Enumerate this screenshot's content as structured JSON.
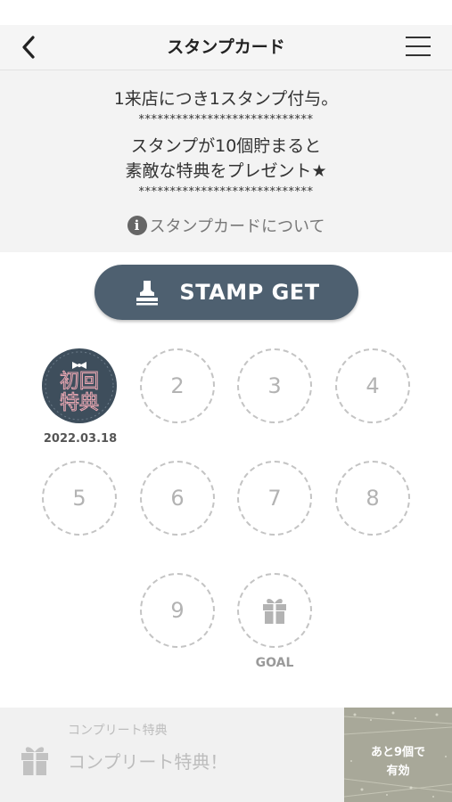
{
  "nav": {
    "title": "スタンプカード"
  },
  "info": {
    "line1": "1来店につき1スタンプ付与。",
    "stars1": "****************************",
    "line2": "スタンプが10個貯まると",
    "line3": "素敵な特典をプレゼント★",
    "stars2": "****************************",
    "about_label": "スタンプカードについて",
    "about_icon": "i"
  },
  "stamp_button": {
    "label": "STAMP GET",
    "icon": "stamp-icon"
  },
  "stamps": {
    "first": {
      "badge_line1": "初回",
      "badge_line2": "特典",
      "date": "2022.03.18"
    },
    "empty_numbers": [
      "2",
      "3",
      "4",
      "5",
      "6",
      "7",
      "8",
      "9"
    ],
    "goal_label": "GOAL",
    "goal_icon": "gift-icon"
  },
  "reward": {
    "sub_label": "コンプリート特典",
    "title": "コンプリート特典！",
    "remaining_line1": "あと9個で",
    "remaining_line2": "有効",
    "icon": "gift-icon"
  },
  "colors": {
    "primary": "#4e6070",
    "badge_bg": "#3e4e5c",
    "badge_text": "#e8a7b2",
    "dash": "#c4c4c4"
  }
}
